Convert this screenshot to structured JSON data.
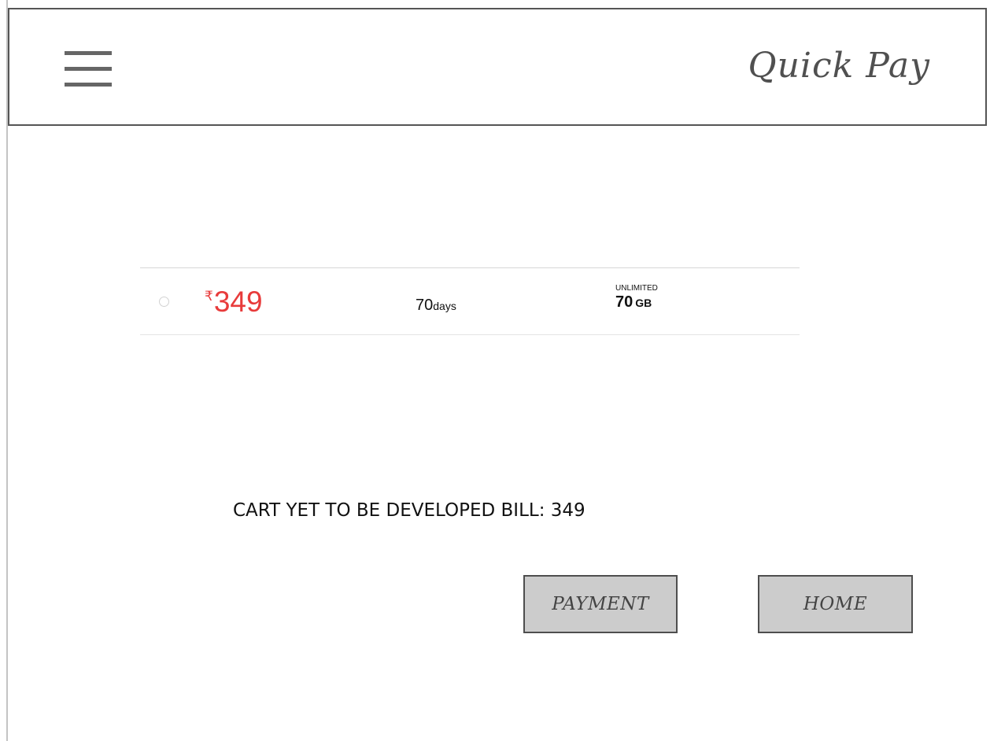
{
  "header": {
    "menu_icon": "hamburger-menu-icon",
    "title": "Quick Pay"
  },
  "plan": {
    "selected": false,
    "currency_symbol": "₹",
    "price": "349",
    "validity_value": "70",
    "validity_unit": "days",
    "data_label": "UNLIMITED",
    "data_value": "70",
    "data_unit": "GB",
    "price_color": "#e83b3b"
  },
  "cart": {
    "message": "CART YET TO BE DEVELOPED BILL: 349"
  },
  "actions": {
    "payment_label": "PAYMENT",
    "home_label": "HOME"
  }
}
